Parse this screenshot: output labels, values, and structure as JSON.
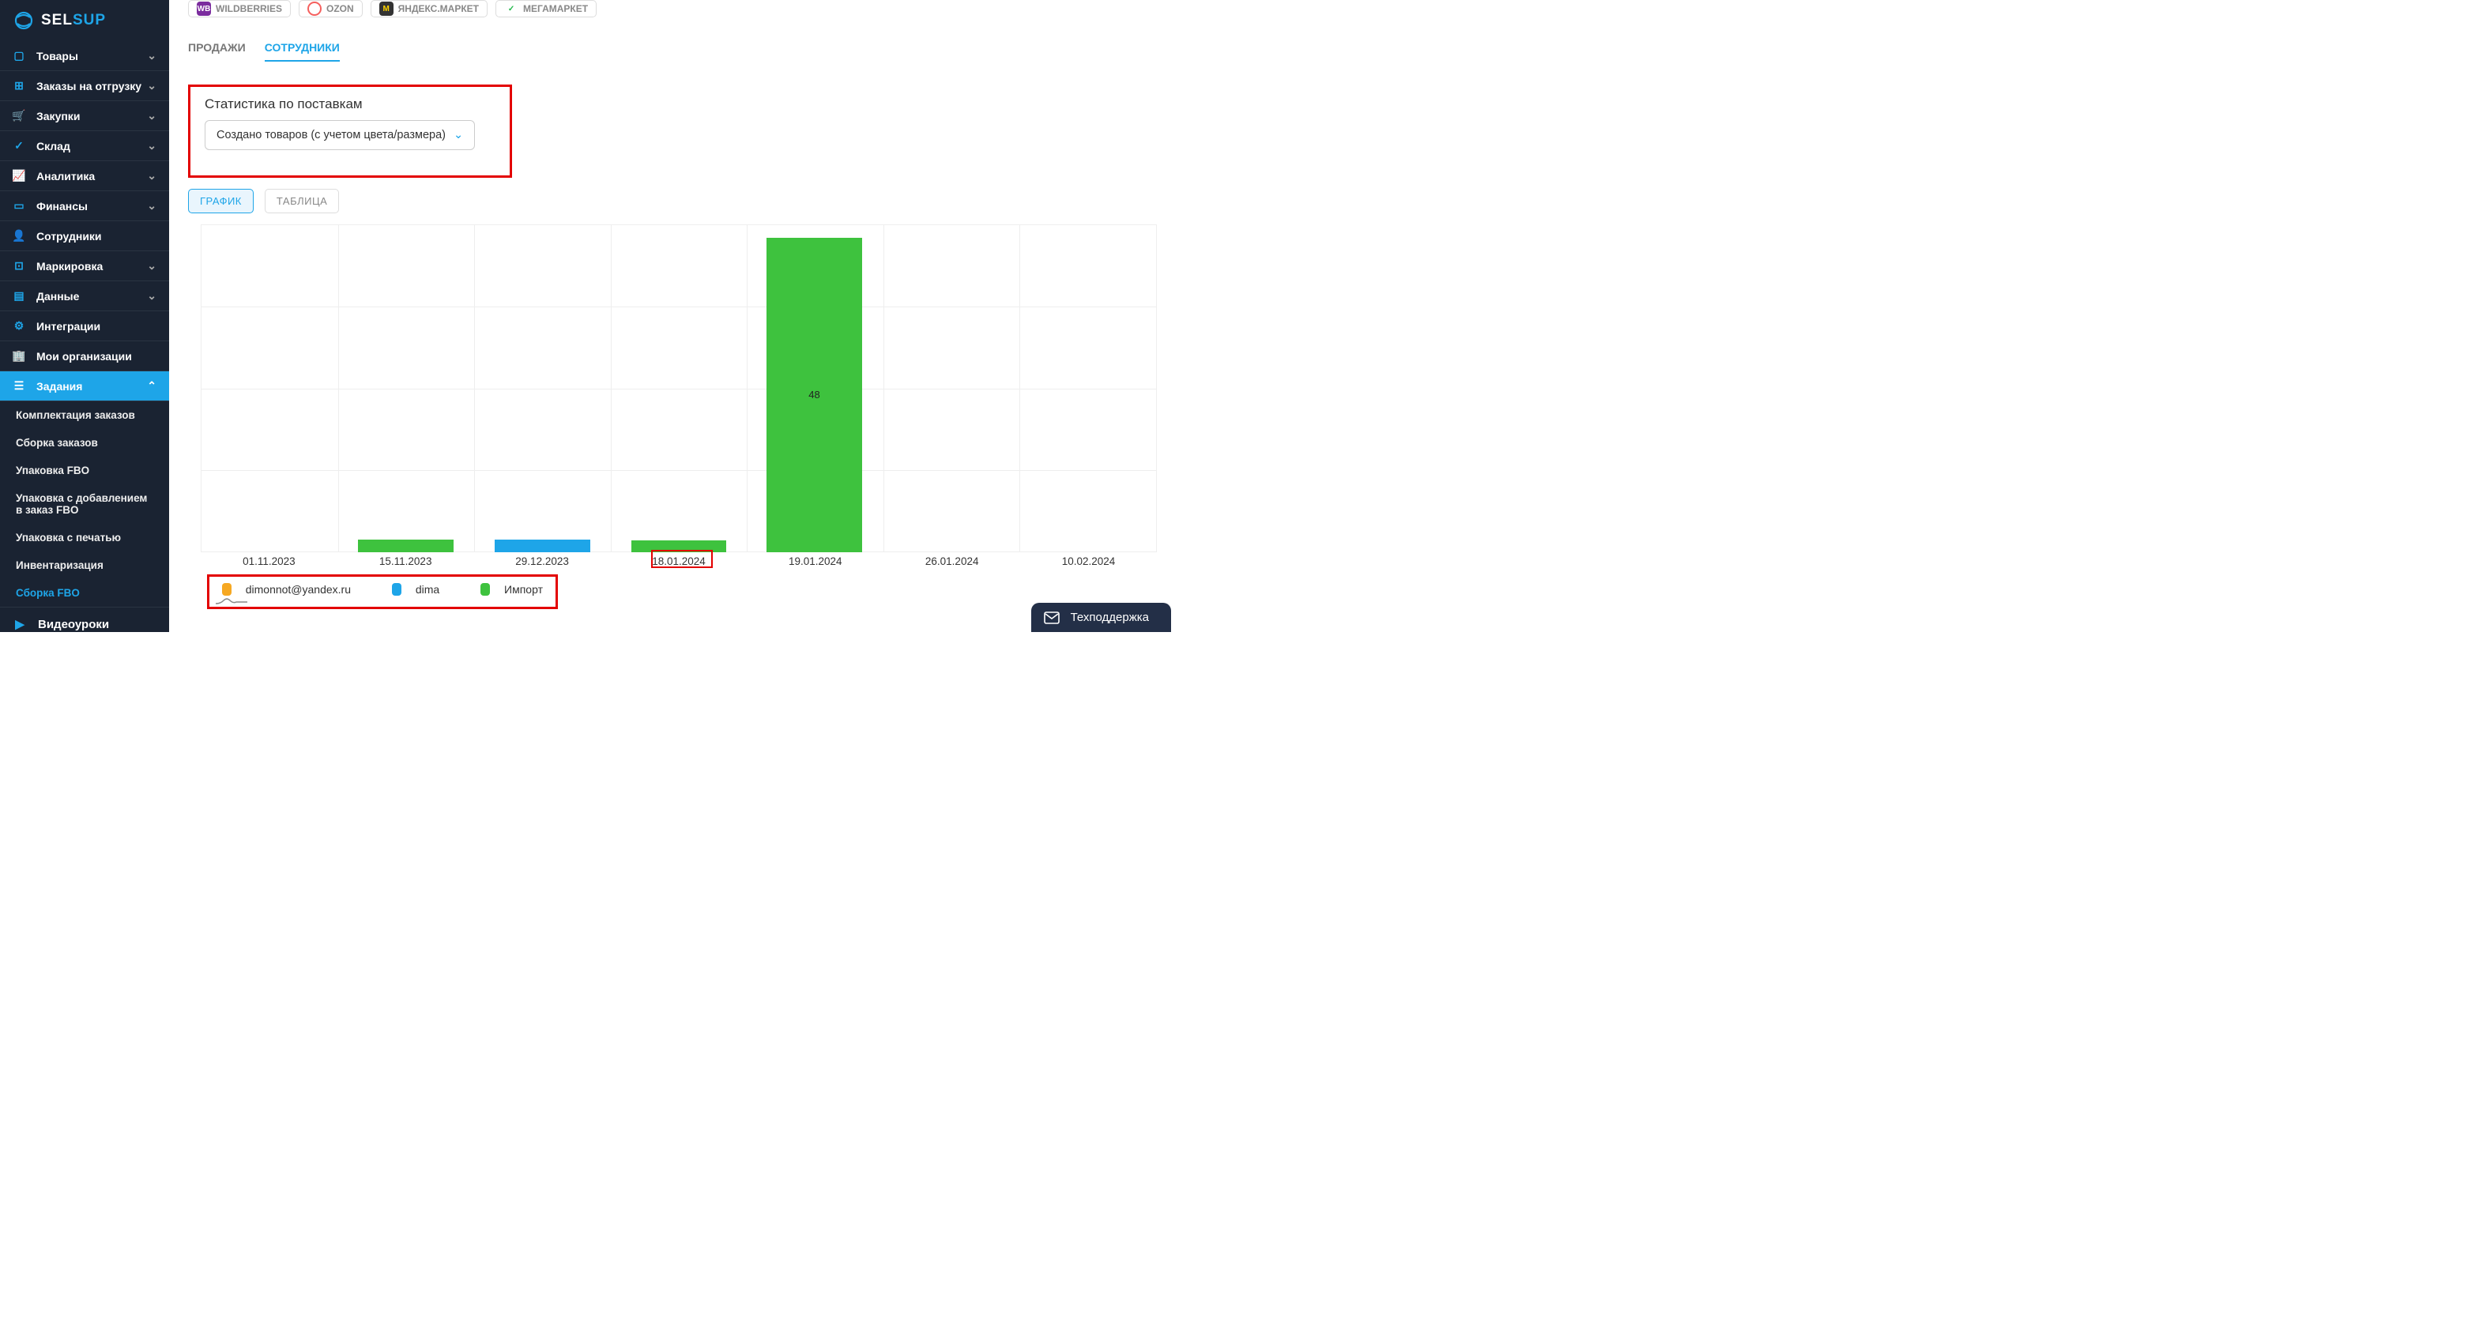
{
  "logo": {
    "sel": "SEL",
    "sup": "SUP"
  },
  "sidebar": {
    "items": [
      {
        "label": "Товары",
        "expand": true
      },
      {
        "label": "Заказы на отгрузку",
        "expand": true
      },
      {
        "label": "Закупки",
        "expand": true
      },
      {
        "label": "Склад",
        "expand": true
      },
      {
        "label": "Аналитика",
        "expand": true
      },
      {
        "label": "Финансы",
        "expand": true
      },
      {
        "label": "Сотрудники",
        "expand": false
      },
      {
        "label": "Маркировка",
        "expand": true
      },
      {
        "label": "Данные",
        "expand": true
      },
      {
        "label": "Интеграции",
        "expand": false
      },
      {
        "label": "Мои организации",
        "expand": false
      },
      {
        "label": "Задания",
        "expand": true
      }
    ],
    "sub_items": [
      {
        "label": "Комплектация заказов"
      },
      {
        "label": "Сборка заказов"
      },
      {
        "label": "Упаковка FBO"
      },
      {
        "label": "Упаковка с добавлением в заказ FBO"
      },
      {
        "label": "Упаковка с печатью"
      },
      {
        "label": "Инвентаризация"
      },
      {
        "label": "Сборка FBO"
      }
    ],
    "video": "Видеоуроки"
  },
  "marketplaces": [
    {
      "label": "WILDBERRIES"
    },
    {
      "label": "OZON"
    },
    {
      "label": "ЯНДЕКС.МАРКЕТ"
    },
    {
      "label": "МЕГАМАРКЕТ"
    }
  ],
  "subtabs": [
    {
      "label": "ПРОДАЖИ"
    },
    {
      "label": "СОТРУДНИКИ"
    }
  ],
  "stat": {
    "title": "Статистика по поставкам",
    "select": "Создано товаров (с учетом цвета/размера)"
  },
  "view": [
    {
      "label": "ГРАФИК"
    },
    {
      "label": "ТАБЛИЦА"
    }
  ],
  "chart_data": {
    "type": "bar",
    "categories": [
      "01.11.2023",
      "15.11.2023",
      "29.12.2023",
      "18.01.2024",
      "19.01.2024",
      "26.01.2024",
      "10.02.2024"
    ],
    "series": [
      {
        "name": "dimonnot@yandex.ru",
        "color": "#f6a822",
        "values": [
          0,
          0,
          0,
          0,
          0,
          0,
          0
        ]
      },
      {
        "name": "dima",
        "color": "#1ea5e8",
        "values": [
          0,
          0,
          2,
          0,
          0,
          0,
          0
        ]
      },
      {
        "name": "Импорт",
        "color": "#3ec23e",
        "values": [
          0,
          2,
          0,
          2,
          48,
          0,
          0
        ]
      }
    ],
    "ylim": [
      0,
      50
    ],
    "bar_label": "48"
  },
  "legend": [
    {
      "label": "dimonnot@yandex.ru"
    },
    {
      "label": "dima"
    },
    {
      "label": "Импорт"
    }
  ],
  "support": "Техподдержка"
}
